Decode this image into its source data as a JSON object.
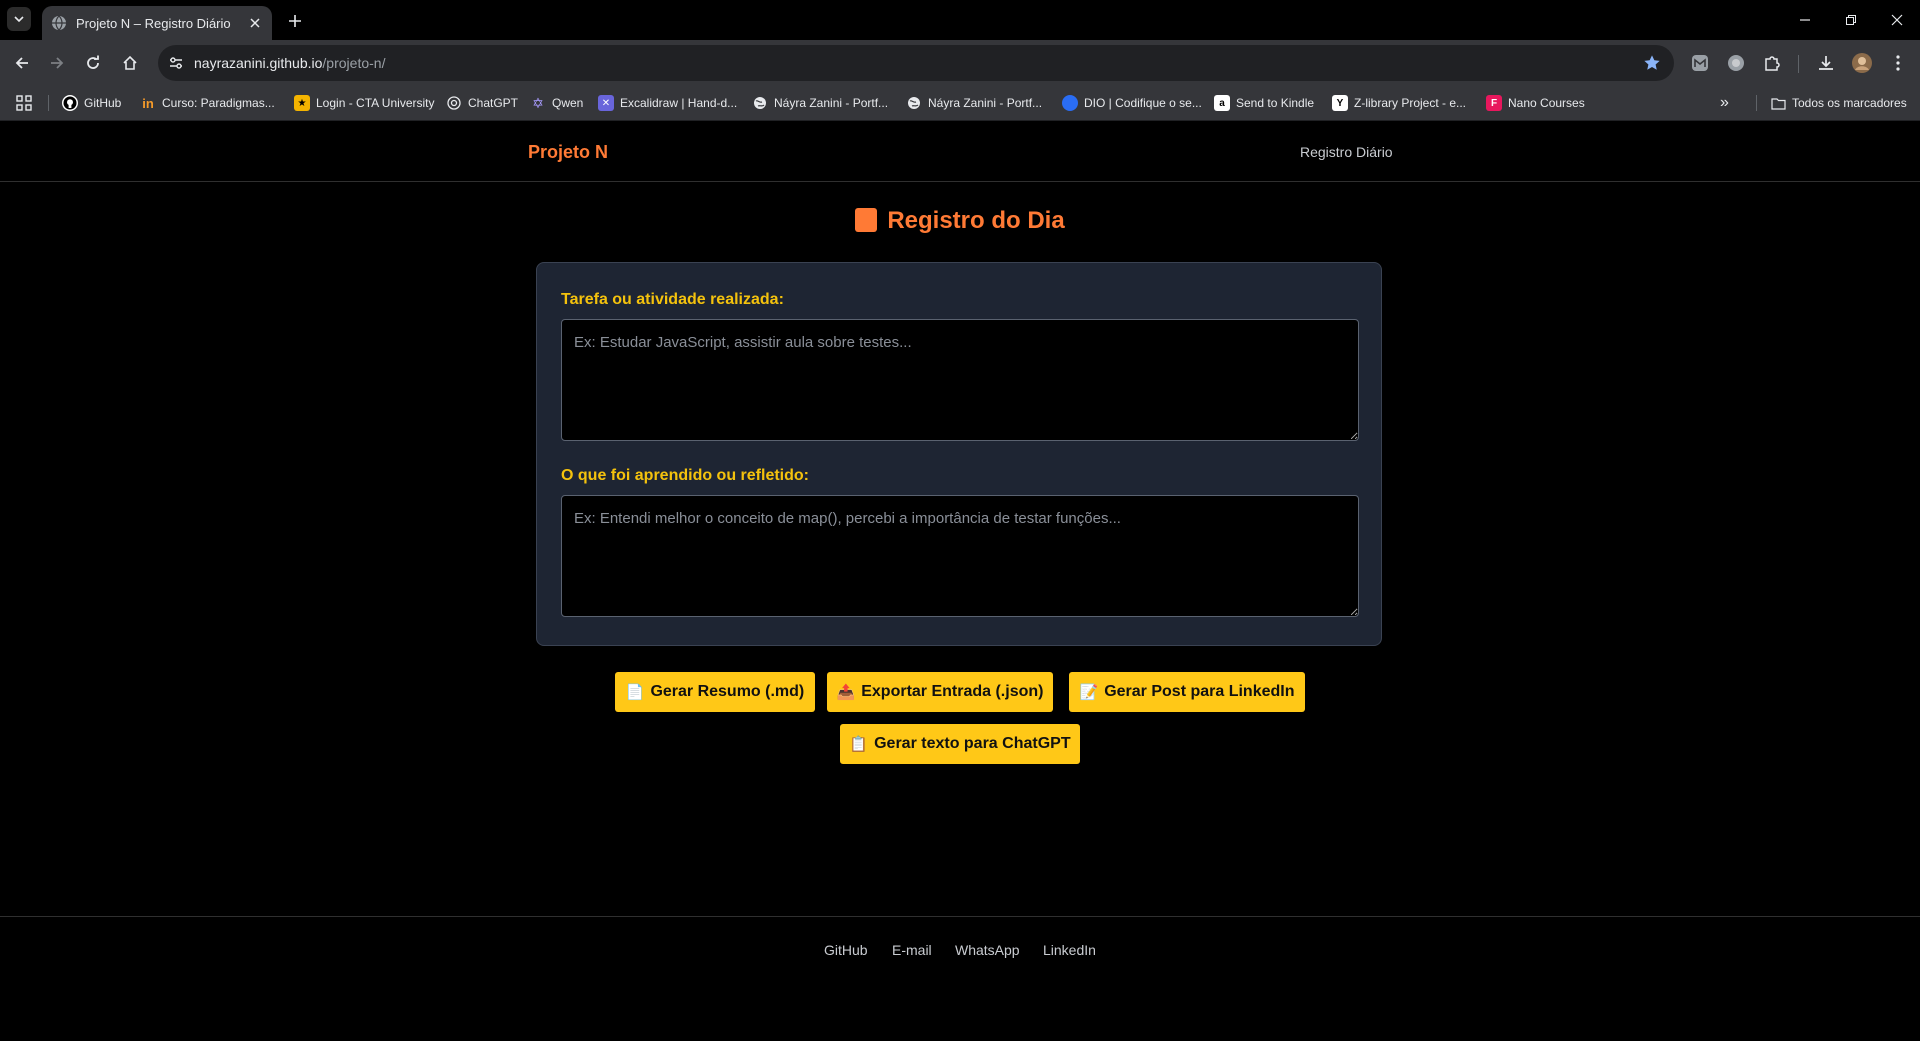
{
  "browser": {
    "tab_title": "Projeto N – Registro Diário",
    "url_host": "nayrazanini.github.io",
    "url_path": "/projeto-n/",
    "bookmarks": [
      {
        "label": "GitHub",
        "icon": "github-icon"
      },
      {
        "label": "Curso: Paradigmas...",
        "icon": "course-icon"
      },
      {
        "label": "Login - CTA University",
        "icon": "cta-icon"
      },
      {
        "label": "ChatGPT",
        "icon": "chatgpt-icon"
      },
      {
        "label": "Qwen",
        "icon": "qwen-icon"
      },
      {
        "label": "Excalidraw | Hand-d...",
        "icon": "excalidraw-icon"
      },
      {
        "label": "Náyra Zanini - Portf...",
        "icon": "globe-icon"
      },
      {
        "label": "Náyra Zanini - Portf...",
        "icon": "globe-icon"
      },
      {
        "label": "DIO | Codifique o se...",
        "icon": "dio-icon"
      },
      {
        "label": "Send to Kindle",
        "icon": "amazon-icon"
      },
      {
        "label": "Z-library Project - e...",
        "icon": "zlibrary-icon"
      },
      {
        "label": "Nano Courses",
        "icon": "nano-icon"
      }
    ],
    "all_bookmarks_label": "Todos os marcadores"
  },
  "header": {
    "brand": "Projeto N",
    "nav_link": "Registro Diário"
  },
  "main": {
    "title": "Registro do Dia",
    "task_label": "Tarefa ou atividade realizada:",
    "task_placeholder": "Ex: Estudar JavaScript, assistir aula sobre testes...",
    "task_value": "",
    "learned_label": "O que foi aprendido ou refletido:",
    "learned_placeholder": "Ex: Entendi melhor o conceito de map(), percebi a importância de testar funções...",
    "learned_value": ""
  },
  "buttons": {
    "summary": "Gerar Resumo (.md)",
    "export": "Exportar Entrada (.json)",
    "linkedin": "Gerar Post para LinkedIn",
    "chatgpt": "Gerar texto para ChatGPT"
  },
  "footer": {
    "links": [
      "GitHub",
      "E-mail",
      "WhatsApp",
      "LinkedIn"
    ]
  },
  "colors": {
    "accent_orange": "#ff7a35",
    "label_yellow": "#f4c20d",
    "button_yellow": "#ffc817",
    "card_bg": "#1e2533"
  }
}
